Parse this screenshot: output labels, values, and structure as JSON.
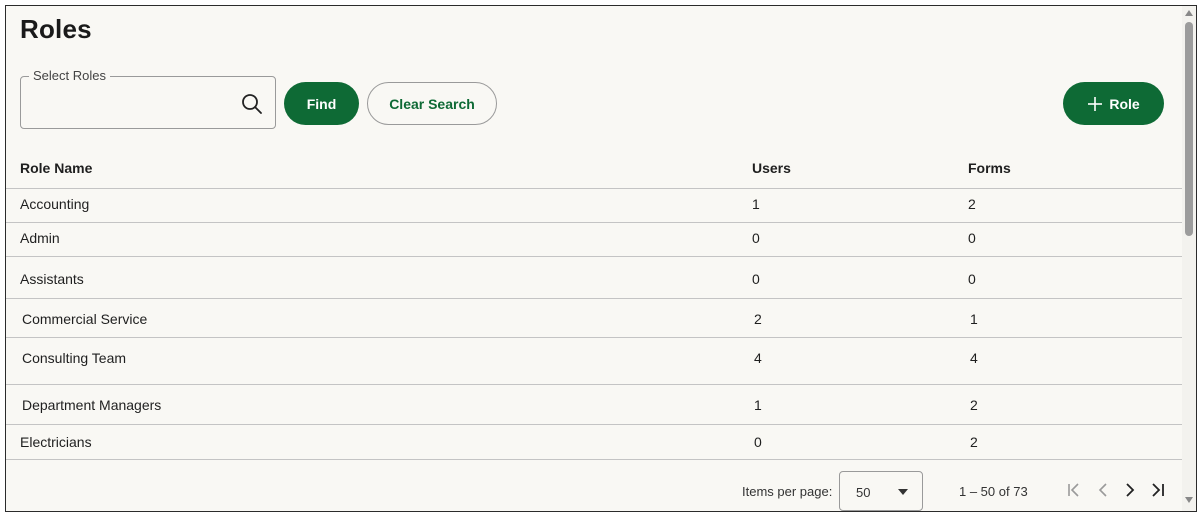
{
  "page": {
    "title": "Roles"
  },
  "search": {
    "label": "Select Roles",
    "value": "",
    "icon": "search-icon"
  },
  "buttons": {
    "find": "Find",
    "clear": "Clear Search",
    "add_role": "Role"
  },
  "colors": {
    "primary": "#0e6a35",
    "background": "#f9f8f4",
    "border": "#c4c4c4"
  },
  "table": {
    "columns": {
      "name": "Role Name",
      "users": "Users",
      "forms": "Forms"
    },
    "rows": [
      {
        "name": "Accounting",
        "users": "1",
        "forms": "2"
      },
      {
        "name": "Admin",
        "users": "0",
        "forms": "0"
      },
      {
        "name": "Assistants",
        "users": "0",
        "forms": "0"
      },
      {
        "name": "Commercial Service",
        "users": "2",
        "forms": "1"
      },
      {
        "name": "Consulting Team",
        "users": "4",
        "forms": "4"
      },
      {
        "name": "Department Managers",
        "users": "1",
        "forms": "2"
      },
      {
        "name": "Electricians",
        "users": "0",
        "forms": "2"
      }
    ]
  },
  "paginator": {
    "items_per_page_label": "Items per page:",
    "items_per_page": "50",
    "range": "1 – 50 of 73"
  }
}
